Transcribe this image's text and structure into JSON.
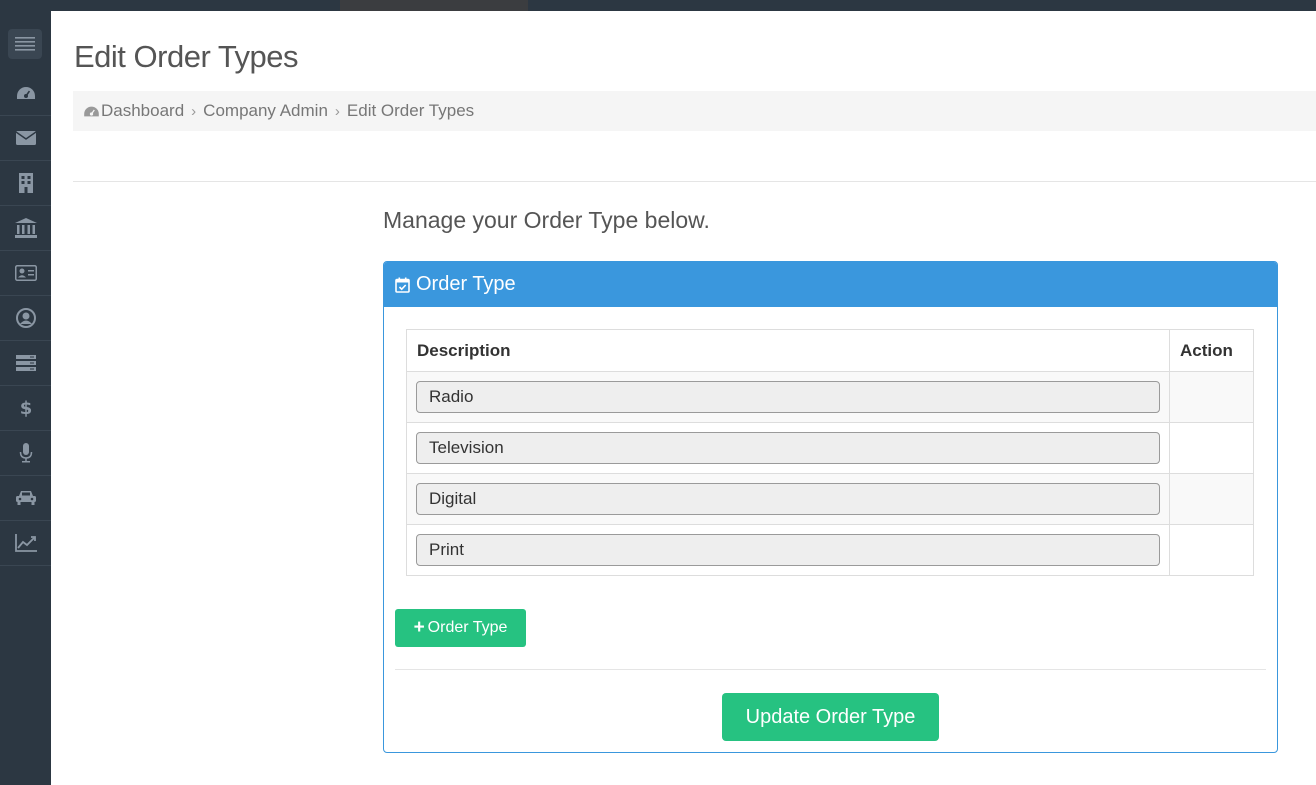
{
  "page": {
    "title": "Edit Order Types",
    "subtitle": "Manage your Order Type below."
  },
  "breadcrumb": {
    "items": [
      "Dashboard",
      "Company Admin",
      "Edit Order Types"
    ],
    "separator": "›"
  },
  "sidebar": {
    "items": [
      {
        "icon": "dashboard-icon"
      },
      {
        "icon": "envelope-icon"
      },
      {
        "icon": "building-icon"
      },
      {
        "icon": "bank-icon"
      },
      {
        "icon": "id-card-icon"
      },
      {
        "icon": "user-circle-icon"
      },
      {
        "icon": "server-icon"
      },
      {
        "icon": "dollar-icon"
      },
      {
        "icon": "microphone-icon"
      },
      {
        "icon": "car-icon"
      },
      {
        "icon": "line-chart-icon"
      }
    ]
  },
  "panel": {
    "heading": "Order Type",
    "heading_icon": "calendar-check-icon",
    "table": {
      "headers": [
        "Description",
        "Action"
      ],
      "rows": [
        {
          "description": "Radio",
          "action": ""
        },
        {
          "description": "Television",
          "action": ""
        },
        {
          "description": "Digital",
          "action": ""
        },
        {
          "description": "Print",
          "action": ""
        }
      ]
    },
    "add_button_label": "Order Type",
    "update_button_label": "Update Order Type"
  },
  "colors": {
    "sidebar_bg": "#2c3742",
    "panel_primary": "#3a97dd",
    "success": "#26c281"
  }
}
